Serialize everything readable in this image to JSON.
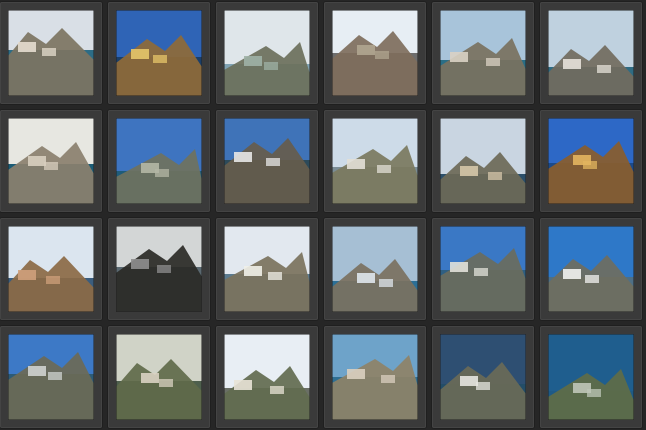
{
  "gallery": {
    "rows": 4,
    "columns": 6,
    "thumbnails": [
      {
        "icon": "coastal-town-cliff-thumbnail",
        "palette": {
          "sky": "#d9dfe6",
          "sea": "#2c6c86",
          "land": "#7d7462",
          "accent": "#e6ddcf"
        }
      },
      {
        "icon": "yellow-building-rock-thumbnail",
        "palette": {
          "sky": "#2f64b6",
          "sea": "#1b3f6a",
          "land": "#8f6a38",
          "accent": "#e6c66a"
        }
      },
      {
        "icon": "mountain-bay-thumbnail",
        "palette": {
          "sky": "#dfe6ea",
          "sea": "#7fa2b3",
          "land": "#6b705b",
          "accent": "#9fb1a6"
        }
      },
      {
        "icon": "street-cars-mountain-thumbnail",
        "palette": {
          "sky": "#e7eef4",
          "sea": "#6d6d6d",
          "land": "#7f6e5c",
          "accent": "#b0a590"
        }
      },
      {
        "icon": "harbor-mountains-thumbnail",
        "palette": {
          "sky": "#a8c4da",
          "sea": "#2a6e86",
          "land": "#7a7160",
          "accent": "#d9d1c4"
        }
      },
      {
        "icon": "cliff-coast-road-thumbnail",
        "palette": {
          "sky": "#bfd1df",
          "sea": "#2f6b83",
          "land": "#726b5e",
          "accent": "#e6e1d9"
        }
      },
      {
        "icon": "sea-cliff-thumbnail",
        "palette": {
          "sky": "#e7e7e1",
          "sea": "#1b5c76",
          "land": "#8b806e",
          "accent": "#d8cfbf"
        }
      },
      {
        "icon": "coastline-peninsula-thumbnail",
        "palette": {
          "sky": "#3e74c0",
          "sea": "#1f5c7a",
          "land": "#6f725e",
          "accent": "#b4b7a5"
        }
      },
      {
        "icon": "boat-beach-thumbnail",
        "palette": {
          "sky": "#3f73b8",
          "sea": "#2c4a5a",
          "land": "#665c4c",
          "accent": "#e7e7e7"
        }
      },
      {
        "icon": "beach-town-thumbnail",
        "palette": {
          "sky": "#cddbe8",
          "sea": "#7b8d96",
          "land": "#7b7a5e",
          "accent": "#e2dfd6"
        }
      },
      {
        "icon": "bay-village-thumbnail",
        "palette": {
          "sky": "#c9d5e1",
          "sea": "#2b4f6a",
          "land": "#6d6957",
          "accent": "#d5c6a9"
        }
      },
      {
        "icon": "castle-cliff-thumbnail",
        "palette": {
          "sky": "#2d68c6",
          "sea": "#1b4a8b",
          "land": "#8a5d2c",
          "accent": "#e3b55f"
        }
      },
      {
        "icon": "arches-boats-thumbnail",
        "palette": {
          "sky": "#dbe5ef",
          "sea": "#3b5d7e",
          "land": "#8c6a45",
          "accent": "#cfa07b"
        }
      },
      {
        "icon": "dark-cliff-sea-thumbnail",
        "palette": {
          "sky": "#d3d6d6",
          "sea": "#5a6870",
          "land": "#2a2a26",
          "accent": "#8f8f8f"
        }
      },
      {
        "icon": "white-town-hill-thumbnail",
        "palette": {
          "sky": "#e2e8ef",
          "sea": "#5a7a8f",
          "land": "#7b725d",
          "accent": "#f0efe8"
        }
      },
      {
        "icon": "promontory-blue-sea-thumbnail",
        "palette": {
          "sky": "#a6bfd4",
          "sea": "#2c6f96",
          "land": "#7b7160",
          "accent": "#dfe6ec"
        }
      },
      {
        "icon": "hillside-bridge-thumbnail",
        "palette": {
          "sky": "#3a78c5",
          "sea": "#2e5f82",
          "land": "#6a6d5d",
          "accent": "#e1e1d9"
        }
      },
      {
        "icon": "dense-white-town-thumbnail",
        "palette": {
          "sky": "#2e78c8",
          "sea": "#4e6f86",
          "land": "#6f6e5f",
          "accent": "#f2f2f0"
        }
      },
      {
        "icon": "viaduct-valley-thumbnail",
        "palette": {
          "sky": "#3d79c6",
          "sea": "#2d5b76",
          "land": "#6b6a56",
          "accent": "#cfd3d0"
        }
      },
      {
        "icon": "green-terraces-thumbnail",
        "palette": {
          "sky": "#d0d3c7",
          "sea": "#4e5f4d",
          "land": "#5f6a4a",
          "accent": "#d9d2c2"
        }
      },
      {
        "icon": "tower-hill-village-thumbnail",
        "palette": {
          "sky": "#e8eef4",
          "sea": "#6a6f66",
          "land": "#626b4f",
          "accent": "#e8e3d6"
        }
      },
      {
        "icon": "rocky-coast-cove-thumbnail",
        "palette": {
          "sky": "#6ea3c9",
          "sea": "#2f6f93",
          "land": "#8e8267",
          "accent": "#d9cfbf"
        }
      },
      {
        "icon": "aerial-village-thumbnail",
        "palette": {
          "sky": "#2e4f72",
          "sea": "#234d68",
          "land": "#6a6a57",
          "accent": "#e6e6e0"
        }
      },
      {
        "icon": "winding-road-coast-thumbnail",
        "palette": {
          "sky": "#1f5e8e",
          "sea": "#1e5a86",
          "land": "#5f6d46",
          "accent": "#bfc7b8"
        }
      }
    ]
  }
}
